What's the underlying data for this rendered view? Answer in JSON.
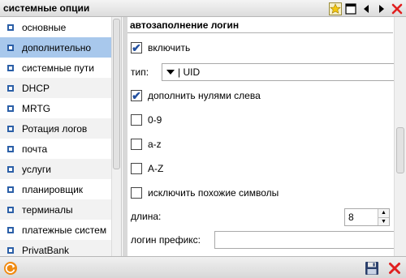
{
  "window": {
    "title": "системные опции"
  },
  "sidebar": {
    "items": [
      {
        "label": "основные"
      },
      {
        "label": "дополнительно"
      },
      {
        "label": "системные пути"
      },
      {
        "label": "DHCP"
      },
      {
        "label": "MRTG"
      },
      {
        "label": "Ротация логов"
      },
      {
        "label": "почта"
      },
      {
        "label": "услуги"
      },
      {
        "label": "планировщик"
      },
      {
        "label": "терминалы"
      },
      {
        "label": "платежные систем"
      },
      {
        "label": "PrivatBank"
      }
    ],
    "selected_index": 1
  },
  "panel": {
    "header": "автозаполнение логин",
    "enable_label": "включить",
    "enable_checked": true,
    "type_label": "тип:",
    "type_value": "| UID",
    "pad_zeros_label": "дополнить нулями слева",
    "pad_zeros_checked": true,
    "digits_label": "0-9",
    "digits_checked": false,
    "lower_label": "a-z",
    "lower_checked": false,
    "upper_label": "A-Z",
    "upper_checked": false,
    "exclude_similar_label": "исключить похожие символы",
    "exclude_similar_checked": false,
    "length_label": "длина:",
    "length_value": "8",
    "prefix_label": "логин префикс:",
    "prefix_value": ""
  },
  "icons": {
    "favorite": "star-icon",
    "window": "window-icon",
    "prev": "prev-arrow-icon",
    "next": "next-arrow-icon",
    "close": "close-icon",
    "refresh": "refresh-icon",
    "save": "save-icon",
    "cancel": "cancel-icon"
  },
  "colors": {
    "selected_row": "#a8c8ec",
    "accent_blue": "#2b5fa7",
    "close_red": "#e02020",
    "refresh_orange": "#f08a10"
  }
}
